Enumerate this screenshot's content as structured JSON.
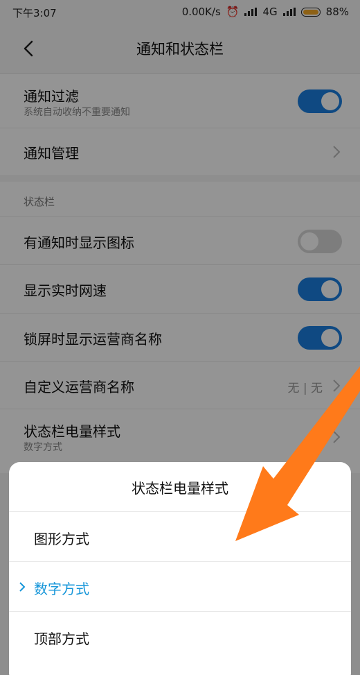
{
  "status_bar": {
    "time": "下午3:07",
    "net_speed": "0.00K/s",
    "network": "4G",
    "battery": "88%"
  },
  "header": {
    "title": "通知和状态栏"
  },
  "notifications": {
    "filter": {
      "label": "通知过滤",
      "sub": "系统自动收纳不重要通知",
      "on": true
    },
    "manage": {
      "label": "通知管理"
    }
  },
  "status_section": {
    "label": "状态栏",
    "items": [
      {
        "label": "有通知时显示图标",
        "on": false
      },
      {
        "label": "显示实时网速",
        "on": true
      },
      {
        "label": "锁屏时显示运营商名称",
        "on": true
      }
    ],
    "carrier": {
      "label": "自定义运营商名称",
      "value": "无 | 无"
    },
    "battery_style": {
      "label": "状态栏电量样式",
      "sub": "数字方式"
    }
  },
  "sheet": {
    "title": "状态栏电量样式",
    "options": [
      {
        "label": "图形方式"
      },
      {
        "label": "数字方式"
      },
      {
        "label": "顶部方式"
      }
    ],
    "selected_index": 1
  },
  "colors": {
    "accent": "#1a7fe0",
    "selected_text": "#1696d9",
    "arrow": "#ff7a1a"
  }
}
